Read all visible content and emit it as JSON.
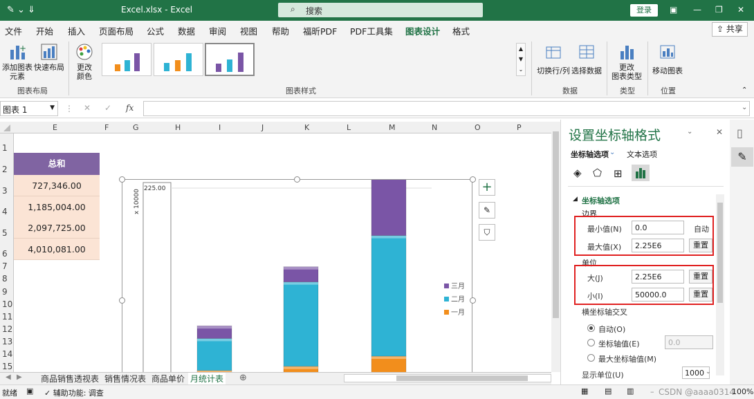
{
  "titlebar": {
    "filename": "Excel.xlsx  -  Excel",
    "search_placeholder": "搜索",
    "login": "登录"
  },
  "menu": {
    "items": [
      "文件",
      "开始",
      "插入",
      "页面布局",
      "公式",
      "数据",
      "审阅",
      "视图",
      "帮助",
      "福昕PDF",
      "PDF工具集",
      "图表设计",
      "格式"
    ],
    "active": "图表设计",
    "share": "共享"
  },
  "ribbon": {
    "add_element": "添加图表\n元素",
    "quick_layout": "快速布局",
    "change_colors": "更改\n颜色",
    "group_layout": "图表布局",
    "group_styles": "图表样式",
    "switch_row_col": "切换行/列",
    "select_data": "选择数据",
    "group_data": "数据",
    "change_type": "更改\n图表类型",
    "group_type": "类型",
    "move_chart": "移动图表",
    "group_location": "位置"
  },
  "formula": {
    "namebox": "图表 1",
    "fx": "fx",
    "value": ""
  },
  "columns": [
    "E",
    "F",
    "G",
    "H",
    "I",
    "J",
    "K",
    "L",
    "M",
    "N",
    "O",
    "P"
  ],
  "rows": [
    "1",
    "2",
    "3",
    "4",
    "5",
    "6",
    "7",
    "8",
    "9",
    "10",
    "11",
    "12",
    "13",
    "14",
    "15"
  ],
  "table": {
    "header": "总和",
    "values": [
      "727,346.00",
      "1,185,004.00",
      "2,097,725.00",
      "4,010,081.00"
    ]
  },
  "chart_data": {
    "type": "bar",
    "stacked": true,
    "axis_label": "x 10000",
    "axis_max_label": "225.00",
    "categories": [
      "",
      "",
      ""
    ],
    "series": [
      {
        "name": "一月",
        "color": "#f28e1c",
        "values": [
          0.1,
          0.15,
          0.27
        ]
      },
      {
        "name": "二月",
        "color": "#2eb3d4",
        "values": [
          0.38,
          1.0,
          1.43
        ]
      },
      {
        "name": "三月",
        "color": "#7a55a6",
        "values": [
          0.15,
          0.18,
          0.98
        ]
      }
    ],
    "legend": [
      "三月",
      "二月",
      "一月"
    ],
    "legend_position": "right"
  },
  "sheet_tabs": {
    "tabs": [
      "商品销售透视表",
      "销售情况表",
      "商品单价",
      "月统计表"
    ],
    "active": "月统计表"
  },
  "status": {
    "ready": "就绪",
    "accessibility": "辅助功能: 调查",
    "zoom": "100%",
    "watermark": "CSDN @aaaa0314"
  },
  "panel": {
    "title": "设置坐标轴格式",
    "tab_axis": "坐标轴选项",
    "tab_text": "文本选项",
    "section": "坐标轴选项",
    "bounds": "边界",
    "min_label": "最小值(N)",
    "min_value": "0.0",
    "min_state": "自动",
    "max_label": "最大值(X)",
    "max_value": "2.25E6",
    "reset": "重置",
    "units": "单位",
    "major_label": "大(J)",
    "major_value": "2.25E6",
    "minor_label": "小(I)",
    "minor_value": "50000.0",
    "cross": "横坐标轴交叉",
    "auto": "自动(O)",
    "axis_value": "坐标轴值(E)",
    "axis_value_input": "0.0",
    "max_axis": "最大坐标轴值(M)",
    "display_units": "显示单位(U)",
    "display_units_value": "1000"
  }
}
